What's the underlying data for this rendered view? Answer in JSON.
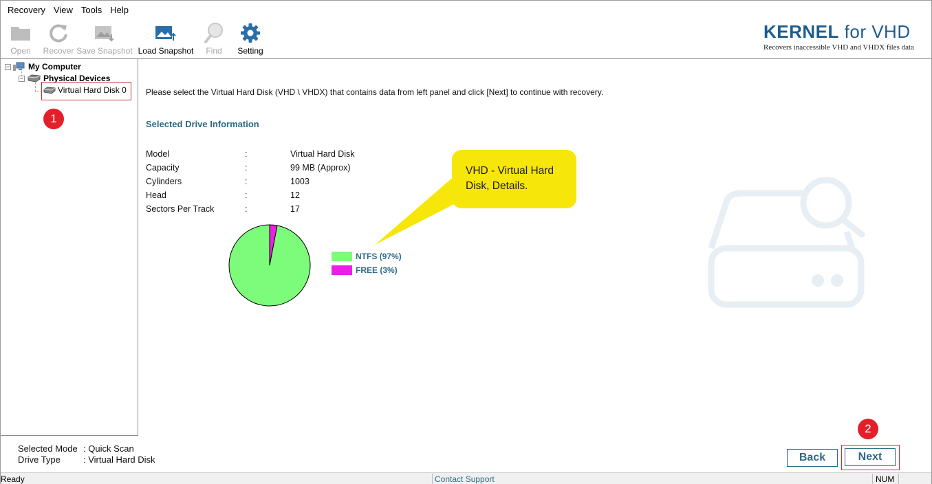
{
  "menu": [
    "Recovery",
    "View",
    "Tools",
    "Help"
  ],
  "toolbar": {
    "open": "Open",
    "recover": "Recover",
    "save_snapshot": "Save Snapshot",
    "load_snapshot": "Load Snapshot",
    "find": "Find",
    "setting": "Setting"
  },
  "brand": {
    "name_bold": "KERNEL",
    "name_rest": " for VHD",
    "tagline": "Recovers inaccessible VHD and VHDX files data"
  },
  "tree": {
    "root": "My Computer",
    "physical": "Physical Devices",
    "disk": "Virtual Hard Disk 0"
  },
  "badges": {
    "one": "1",
    "two": "2"
  },
  "instruction": "Please select the Virtual Hard Disk (VHD \\ VHDX) that contains data from left panel and click [Next] to continue with recovery.",
  "section_title": "Selected Drive Information",
  "drive_info": {
    "separator": ":",
    "rows": [
      {
        "label": "Model",
        "value": "Virtual Hard Disk"
      },
      {
        "label": "Capacity",
        "value": "99 MB (Approx)"
      },
      {
        "label": "Cylinders",
        "value": "1003"
      },
      {
        "label": "Head",
        "value": "12"
      },
      {
        "label": "Sectors Per Track",
        "value": "17"
      }
    ]
  },
  "chart_data": {
    "type": "pie",
    "slices": [
      {
        "label": "NTFS (97%)",
        "value": 97,
        "color": "#7dfb7a"
      },
      {
        "label": "FREE (3%)",
        "value": 3,
        "color": "#ee1ee6"
      }
    ]
  },
  "callout": "VHD - Virtual Hard Disk, Details.",
  "footer": {
    "mode_label": "Selected Mode",
    "mode_value": ": Quick Scan",
    "type_label": "Drive Type",
    "type_value": ": Virtual Hard Disk",
    "back": "Back",
    "next": "Next"
  },
  "status": {
    "left": "Ready",
    "center": "Contact Support",
    "right": "NUM"
  },
  "colors": {
    "accent": "#2c6b86",
    "brand": "#1d5c8f",
    "highlight": "#d42a2a",
    "callout": "#f7e60a"
  }
}
